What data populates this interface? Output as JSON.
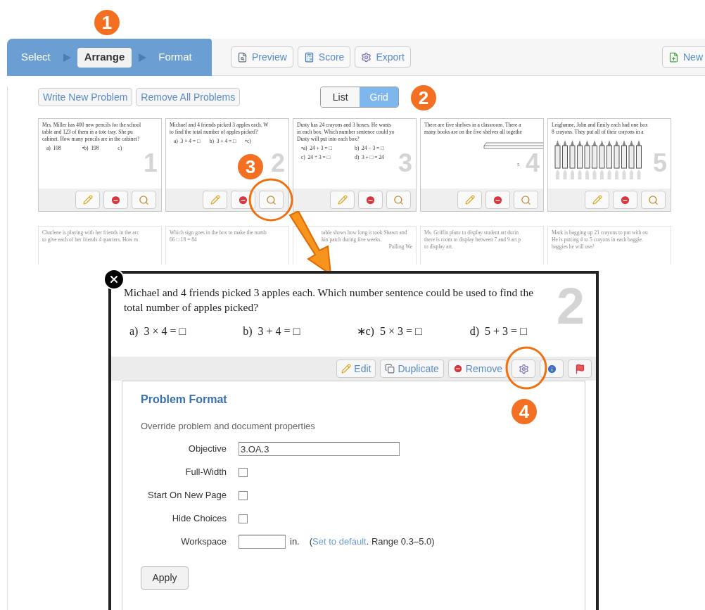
{
  "steps": [
    {
      "label": "Select",
      "selected": false
    },
    {
      "label": "Arrange",
      "selected": true
    },
    {
      "label": "Format",
      "selected": false
    }
  ],
  "toolbar": [
    {
      "label": "Preview",
      "kind": "preview"
    },
    {
      "label": "Score",
      "kind": "score"
    },
    {
      "label": "Export",
      "kind": "export"
    }
  ],
  "new_button": "New",
  "actions": [
    "Write New Problem",
    "Remove All Problems"
  ],
  "view_toggle": [
    {
      "label": "List",
      "selected": false
    },
    {
      "label": "Grid",
      "selected": true
    }
  ],
  "cards": [
    {
      "number": "1",
      "lines": [
        "Mrs. Miller has 400 new pencils for the school",
        "table and 123 of them in a tote tray. She pu",
        "cabinet. How many pencils are in the cabinet?"
      ],
      "choices": [
        "a)  108",
        "•b)  198",
        "c)"
      ]
    },
    {
      "number": "2",
      "lines": [
        "Michael and 4 friends picked 3 apples each. W",
        "to find the total number of apples picked?"
      ],
      "choices": [
        "a)  3 × 4 = □",
        "b)  3 + 4 = □",
        "•c)"
      ]
    },
    {
      "number": "3",
      "lines": [
        "Dusty has 24 crayons and 3 boxes. He wants",
        "in each box. Which number sentence could yo",
        "Dusty will put into each box?"
      ],
      "choices": [
        "•a)  24 + 3 = □",
        "b)  24 − 3 = □",
        "c)  24 ÷ 3 = □",
        "d)  3 + □ = 24"
      ]
    },
    {
      "number": "4",
      "lines": [
        "There are five shelves in a classroom. There a",
        "many books are on the five shelves all togethe"
      ],
      "figure": {
        "kind": "shelf",
        "label": "5"
      }
    },
    {
      "number": "5",
      "lines": [
        "Leighanne, John and Emily each had one box",
        "8 crayons. They put all of their crayons in a"
      ],
      "figure": {
        "kind": "crayons"
      }
    }
  ],
  "cards_row_2": [
    {
      "lines": [
        "Charlene is playing with her friends in the arc",
        "to give each of her friends 4 quarters. How m"
      ]
    },
    {
      "lines": [
        "Which sign goes in the box to make the numb",
        "66 □ 18 = 84"
      ]
    },
    {
      "lines": [
        "table shows how long it took Shawn and",
        "kin patch during five weeks.",
        "Pulling We"
      ]
    },
    {
      "lines": [
        "Ms. Griffin plans to display student art durin",
        "there is room to display between 7 and 9 art p",
        "to display art."
      ]
    },
    {
      "lines": [
        "Mark is bagging up 21 crayons to put with ou",
        "He is putting 4 to 5 crayons in each baggie.",
        "baggies he will use?"
      ]
    }
  ],
  "dialog": {
    "problem": "Michael and 4 friends picked 3 apples each.  Which number sentence could be used to find the total number of apples picked?",
    "number": "2",
    "choices": [
      "a)  3 × 4 = □",
      "b)  3 + 4 = □",
      "∗c)  5 × 3 = □",
      "d)  5 + 3 = □"
    ],
    "buttons": [
      {
        "label": "Edit",
        "kind": "edit"
      },
      {
        "label": "Duplicate",
        "kind": "duplicate"
      },
      {
        "label": "Remove",
        "kind": "remove"
      },
      {
        "kind": "settings"
      },
      {
        "kind": "info"
      },
      {
        "kind": "flag"
      }
    ],
    "panel": {
      "title": "Problem Format",
      "subtitle": "Override problem and document properties",
      "fields": [
        {
          "kind": "text",
          "label": "Objective",
          "value": "3.OA.3"
        },
        {
          "kind": "checkbox",
          "label": "Full-Width",
          "checked": false
        },
        {
          "kind": "checkbox",
          "label": "Start On New Page",
          "checked": false
        },
        {
          "kind": "checkbox",
          "label": "Hide Choices",
          "checked": false
        },
        {
          "kind": "workspace",
          "label": "Workspace",
          "unit": "in.",
          "hint_before": "(",
          "hint_link": "Set to default",
          "hint_after": ". Range 0.3–5.0)"
        }
      ],
      "apply": "Apply"
    }
  },
  "callouts": [
    {
      "label": "1"
    },
    {
      "label": "2"
    },
    {
      "label": "3"
    },
    {
      "label": "4"
    }
  ]
}
